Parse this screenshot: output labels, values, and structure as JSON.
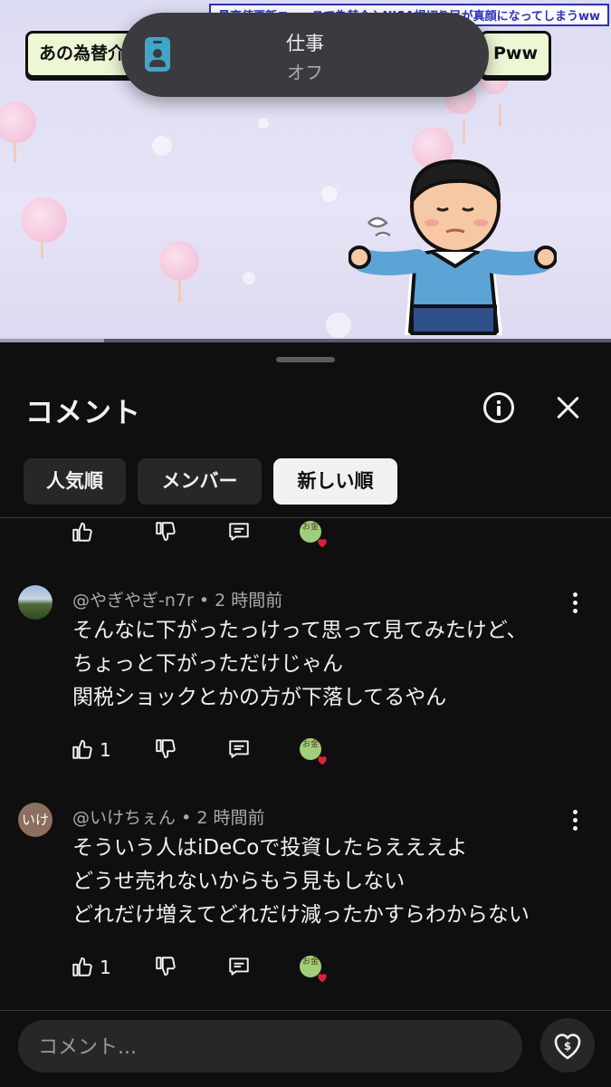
{
  "video": {
    "banner_text": "最高値更新ニュースで為替介入NISA損切り民が真顔になってしまうww",
    "sticker_left": "あの為替介",
    "sticker_right": "Pww",
    "progress_fraction": 0.17
  },
  "notification": {
    "title": "仕事",
    "subtitle": "オフ",
    "icon": "id-badge-icon"
  },
  "sheet": {
    "title": "コメント",
    "info_icon": "info-icon",
    "close_icon": "close-icon",
    "chips": [
      {
        "label": "人気順",
        "active": false
      },
      {
        "label": "メンバー",
        "active": false
      },
      {
        "label": "新しい順",
        "active": true
      }
    ]
  },
  "comments": [
    {
      "author": "@やぎやぎ-n7r",
      "time": "2 時間前",
      "lines": [
        "そんなに下がったっけって思って見てみたけど、",
        "ちょっと下がっただけじゃん",
        "関税ショックとかの方が下落してるやん"
      ],
      "likes": "1",
      "avatar": "landscape-photo"
    },
    {
      "author": "@いけちぇん",
      "time": "2 時間前",
      "avatar_text": "いけ",
      "lines": [
        "そういう人はiDeCoで投資したらえええよ",
        "どうせ売れないからもう見もしない",
        "どれだけ増えてどれだけ減ったかすらわからない"
      ],
      "likes": "1"
    }
  ],
  "sticker_label": "お金",
  "input": {
    "placeholder": "コメント..."
  },
  "colors": {
    "background": "#0f0f0f",
    "chip": "#272727",
    "chip_active": "#f1f1f1",
    "heart": "#e0203a"
  }
}
